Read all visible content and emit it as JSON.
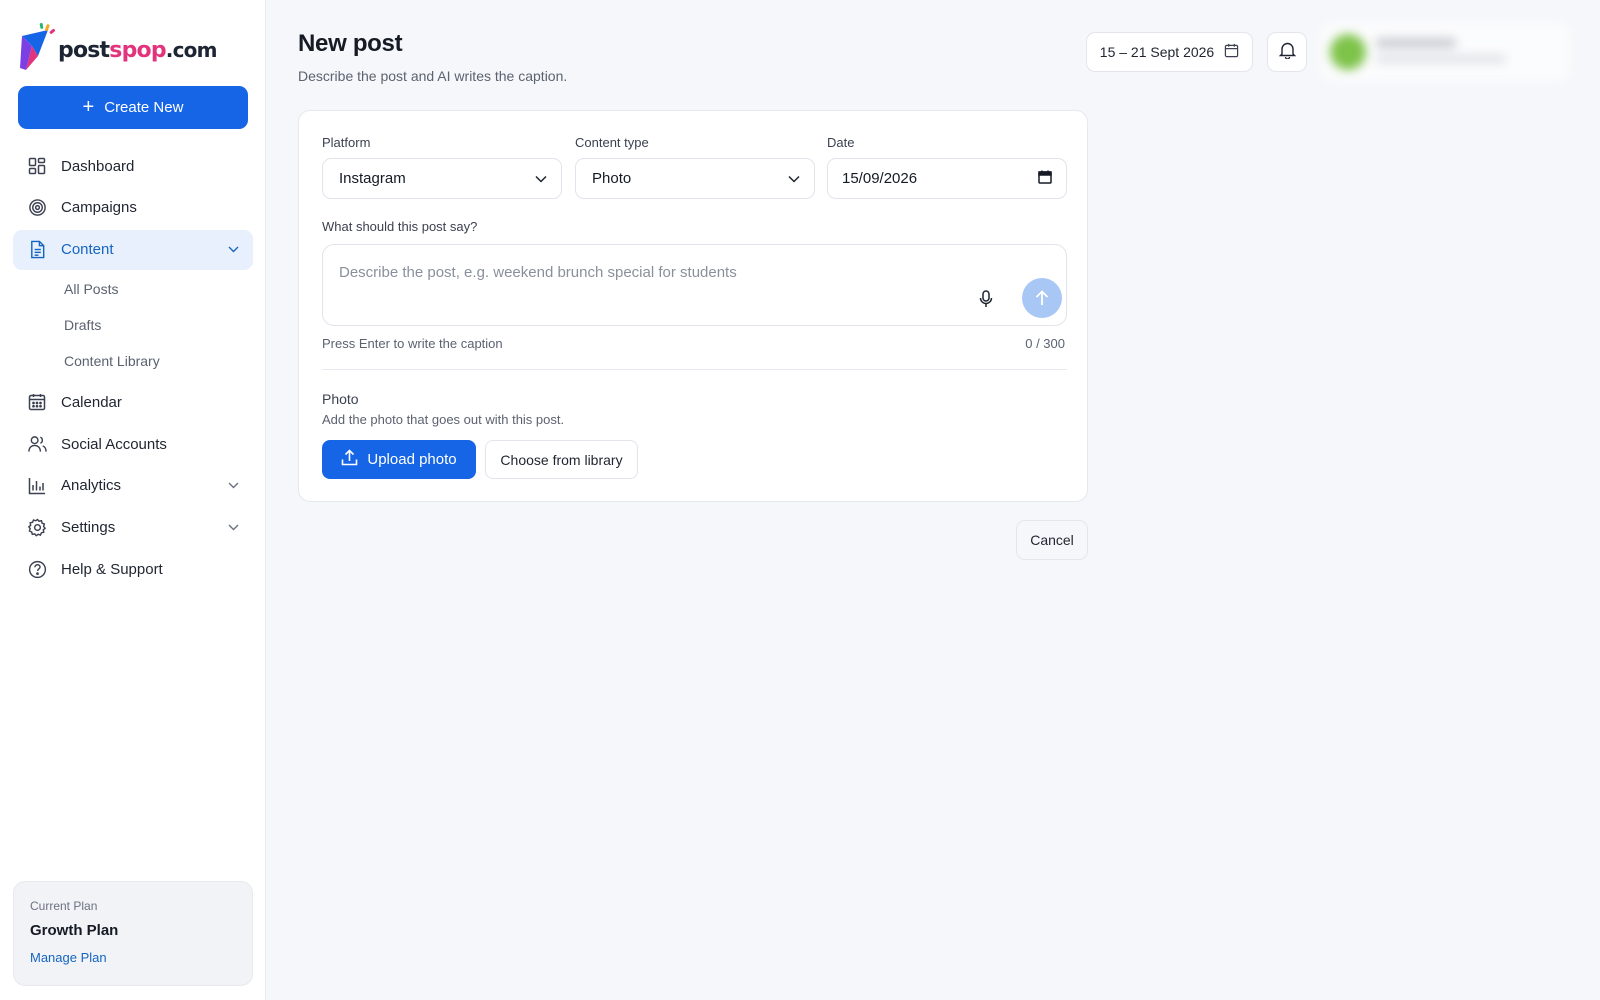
{
  "brand": {
    "logo_post": "post",
    "logo_pop": "spop",
    "logo_dotcom": ".com",
    "logo_text_full": "postspop.com",
    "primary_color": "#1565e6",
    "accent_pink": "#e2347c"
  },
  "sidebar": {
    "create_label": "Create New",
    "items": [
      {
        "label": "Dashboard",
        "icon": "grid-icon"
      },
      {
        "label": "Campaigns",
        "icon": "target-icon"
      },
      {
        "label": "Content",
        "icon": "document-icon",
        "active": true,
        "expanded": true
      },
      {
        "label": "Calendar",
        "icon": "calendar-icon"
      },
      {
        "label": "Social Accounts",
        "icon": "users-icon"
      },
      {
        "label": "Analytics",
        "icon": "bar-chart-icon",
        "has_chevron": true
      },
      {
        "label": "Settings",
        "icon": "gear-icon",
        "has_chevron": true
      },
      {
        "label": "Help & Support",
        "icon": "help-circle-icon"
      }
    ],
    "content_sub": [
      "All Posts",
      "Drafts",
      "Content Library"
    ],
    "plan": {
      "caption": "Current Plan",
      "name": "Growth Plan",
      "link": "Manage Plan"
    }
  },
  "header": {
    "title": "New post",
    "subtitle": "Describe the post and AI writes the caption.",
    "date_range": "15 – 21 Sept 2026"
  },
  "form": {
    "platform_label": "Platform",
    "platform_value": "Instagram",
    "content_type_label": "Content type",
    "content_type_value": "Photo",
    "date_label": "Date",
    "date_value": "15/09/2026",
    "prompt_label": "What should this post say?",
    "prompt_placeholder": "Describe the post, e.g. weekend brunch special for students",
    "hint": "Press Enter to write the caption",
    "counter": "0 / 300",
    "photo_label": "Photo",
    "photo_sub": "Add the photo that goes out with this post.",
    "upload_label": "Upload photo",
    "library_label": "Choose from library"
  },
  "footer": {
    "cancel_label": "Cancel"
  }
}
